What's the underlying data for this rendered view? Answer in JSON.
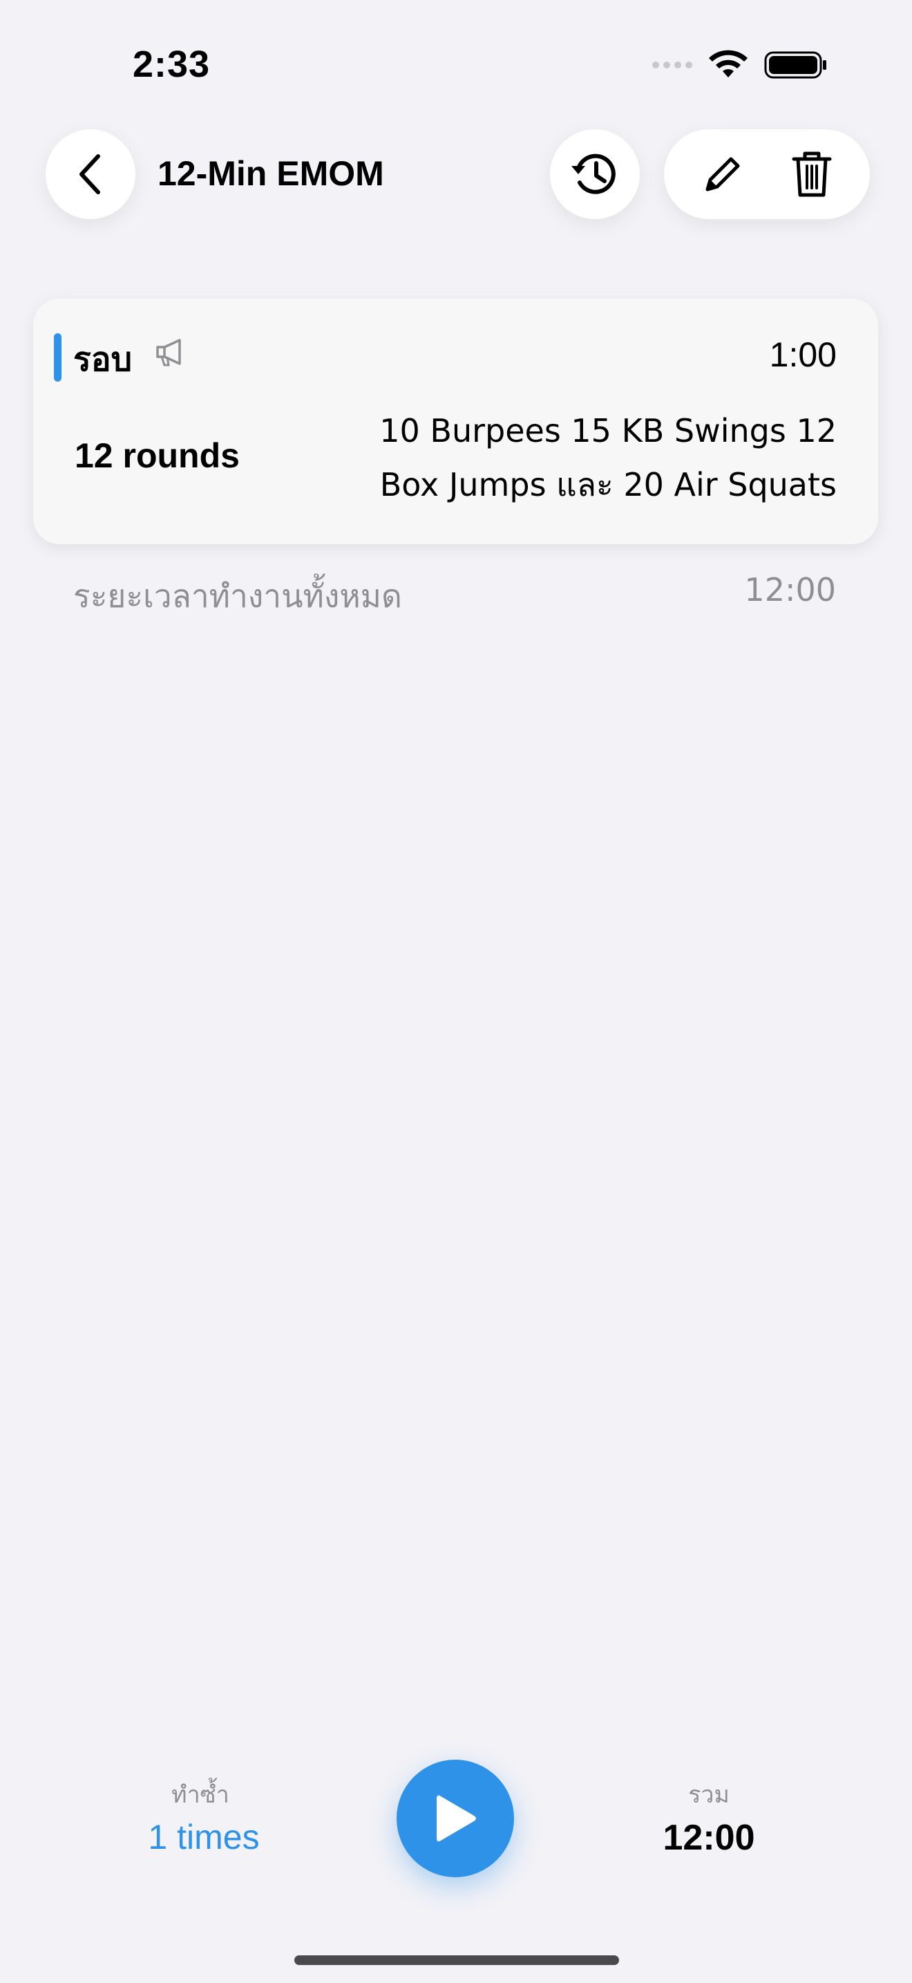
{
  "status_bar": {
    "time": "2:33",
    "icons": [
      "signal-dots-icon",
      "wifi-icon",
      "battery-icon"
    ]
  },
  "header": {
    "title": "12-Min EMOM",
    "back_icon": "chevron-left-icon",
    "history_icon": "history-clock-icon",
    "edit_icon": "pencil-icon",
    "delete_icon": "trash-icon"
  },
  "card": {
    "label": "รอบ",
    "label_icon": "megaphone-icon",
    "interval": "1:00",
    "rounds": "12 rounds",
    "description": "10 Burpees 15 KB Swings 12 Box Jumps และ 20 Air Squats",
    "accent_color": "#2e93e8"
  },
  "total": {
    "label": "ระยะเวลาทำงานทั้งหมด",
    "value": "12:00"
  },
  "bottom": {
    "repeat_label": "ทำซ้ำ",
    "repeat_value": "1 times",
    "play_icon": "play-icon",
    "sum_label": "รวม",
    "sum_value": "12:00"
  },
  "colors": {
    "accent": "#2e93e8",
    "background": "#f2f2f7",
    "secondary_text": "#8e8e93"
  }
}
